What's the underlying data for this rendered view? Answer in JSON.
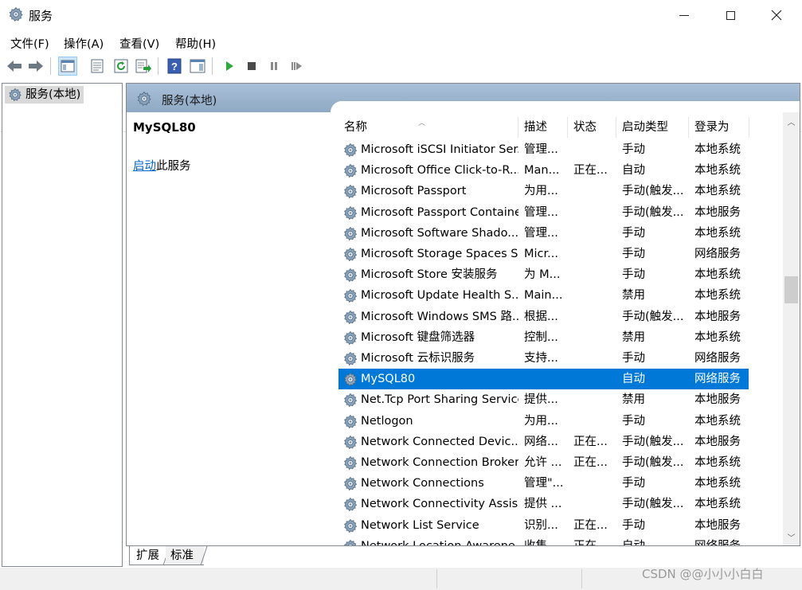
{
  "window": {
    "title": "服务"
  },
  "menu": [
    "文件(F)",
    "操作(A)",
    "查看(V)",
    "帮助(H)"
  ],
  "toolbar": {
    "buttons": [
      "back",
      "forward",
      "show-hide-console-tree",
      "properties",
      "refresh",
      "export-list",
      "help",
      "show-hide-action-pane",
      "start-service",
      "stop-service",
      "pause-service",
      "resume-service"
    ]
  },
  "tree": {
    "root_label": "服务(本地)"
  },
  "pane": {
    "header": "服务(本地)",
    "selected_service": "MySQL80",
    "action_link": "启动",
    "action_suffix": "此服务"
  },
  "columns": {
    "name": "名称",
    "description": "描述",
    "status": "状态",
    "startup_type": "启动类型",
    "logon_as": "登录为"
  },
  "services": [
    {
      "name": "Microsoft iSCSI Initiator Ser...",
      "description": "管理...",
      "status": "",
      "startup_type": "手动",
      "logon_as": "本地系统"
    },
    {
      "name": "Microsoft Office Click-to-R...",
      "description": "Man...",
      "status": "正在...",
      "startup_type": "自动",
      "logon_as": "本地系统"
    },
    {
      "name": "Microsoft Passport",
      "description": "为用...",
      "status": "",
      "startup_type": "手动(触发...",
      "logon_as": "本地系统"
    },
    {
      "name": "Microsoft Passport Container",
      "description": "管理...",
      "status": "",
      "startup_type": "手动(触发...",
      "logon_as": "本地服务"
    },
    {
      "name": "Microsoft Software Shado...",
      "description": "管理...",
      "status": "",
      "startup_type": "手动",
      "logon_as": "本地系统"
    },
    {
      "name": "Microsoft Storage Spaces S...",
      "description": "Micr...",
      "status": "",
      "startup_type": "手动",
      "logon_as": "网络服务"
    },
    {
      "name": "Microsoft Store 安装服务",
      "description": "为 M...",
      "status": "",
      "startup_type": "手动",
      "logon_as": "本地系统"
    },
    {
      "name": "Microsoft Update Health S...",
      "description": "Main...",
      "status": "",
      "startup_type": "禁用",
      "logon_as": "本地系统"
    },
    {
      "name": "Microsoft Windows SMS 路...",
      "description": "根据...",
      "status": "",
      "startup_type": "手动(触发...",
      "logon_as": "本地服务"
    },
    {
      "name": "Microsoft 键盘筛选器",
      "description": "控制...",
      "status": "",
      "startup_type": "禁用",
      "logon_as": "本地系统"
    },
    {
      "name": "Microsoft 云标识服务",
      "description": "支持...",
      "status": "",
      "startup_type": "手动",
      "logon_as": "网络服务"
    },
    {
      "name": "MySQL80",
      "description": "",
      "status": "",
      "startup_type": "自动",
      "logon_as": "网络服务",
      "selected": true
    },
    {
      "name": "Net.Tcp Port Sharing Service",
      "description": "提供...",
      "status": "",
      "startup_type": "禁用",
      "logon_as": "本地服务"
    },
    {
      "name": "Netlogon",
      "description": "为用...",
      "status": "",
      "startup_type": "手动",
      "logon_as": "本地系统"
    },
    {
      "name": "Network Connected Devic...",
      "description": "网络...",
      "status": "正在...",
      "startup_type": "手动(触发...",
      "logon_as": "本地服务"
    },
    {
      "name": "Network Connection Broker",
      "description": "允许 ...",
      "status": "正在...",
      "startup_type": "手动(触发...",
      "logon_as": "本地系统"
    },
    {
      "name": "Network Connections",
      "description": "管理\"...",
      "status": "",
      "startup_type": "手动",
      "logon_as": "本地系统"
    },
    {
      "name": "Network Connectivity Assis...",
      "description": "提供 ...",
      "status": "",
      "startup_type": "手动(触发...",
      "logon_as": "本地系统"
    },
    {
      "name": "Network List Service",
      "description": "识别...",
      "status": "正在...",
      "startup_type": "手动",
      "logon_as": "本地服务"
    },
    {
      "name": "Network Location Awarene...",
      "description": "收集...",
      "status": "正在...",
      "startup_type": "自动",
      "logon_as": "网络服务"
    }
  ],
  "tabs": [
    "扩展",
    "标准"
  ],
  "watermark": "CSDN @@小小小白白",
  "colors": {
    "selection": "#0078d7",
    "link": "#0066cc",
    "header_gradient_top": "#a9c0d8",
    "play_green": "#2eaa3a"
  }
}
